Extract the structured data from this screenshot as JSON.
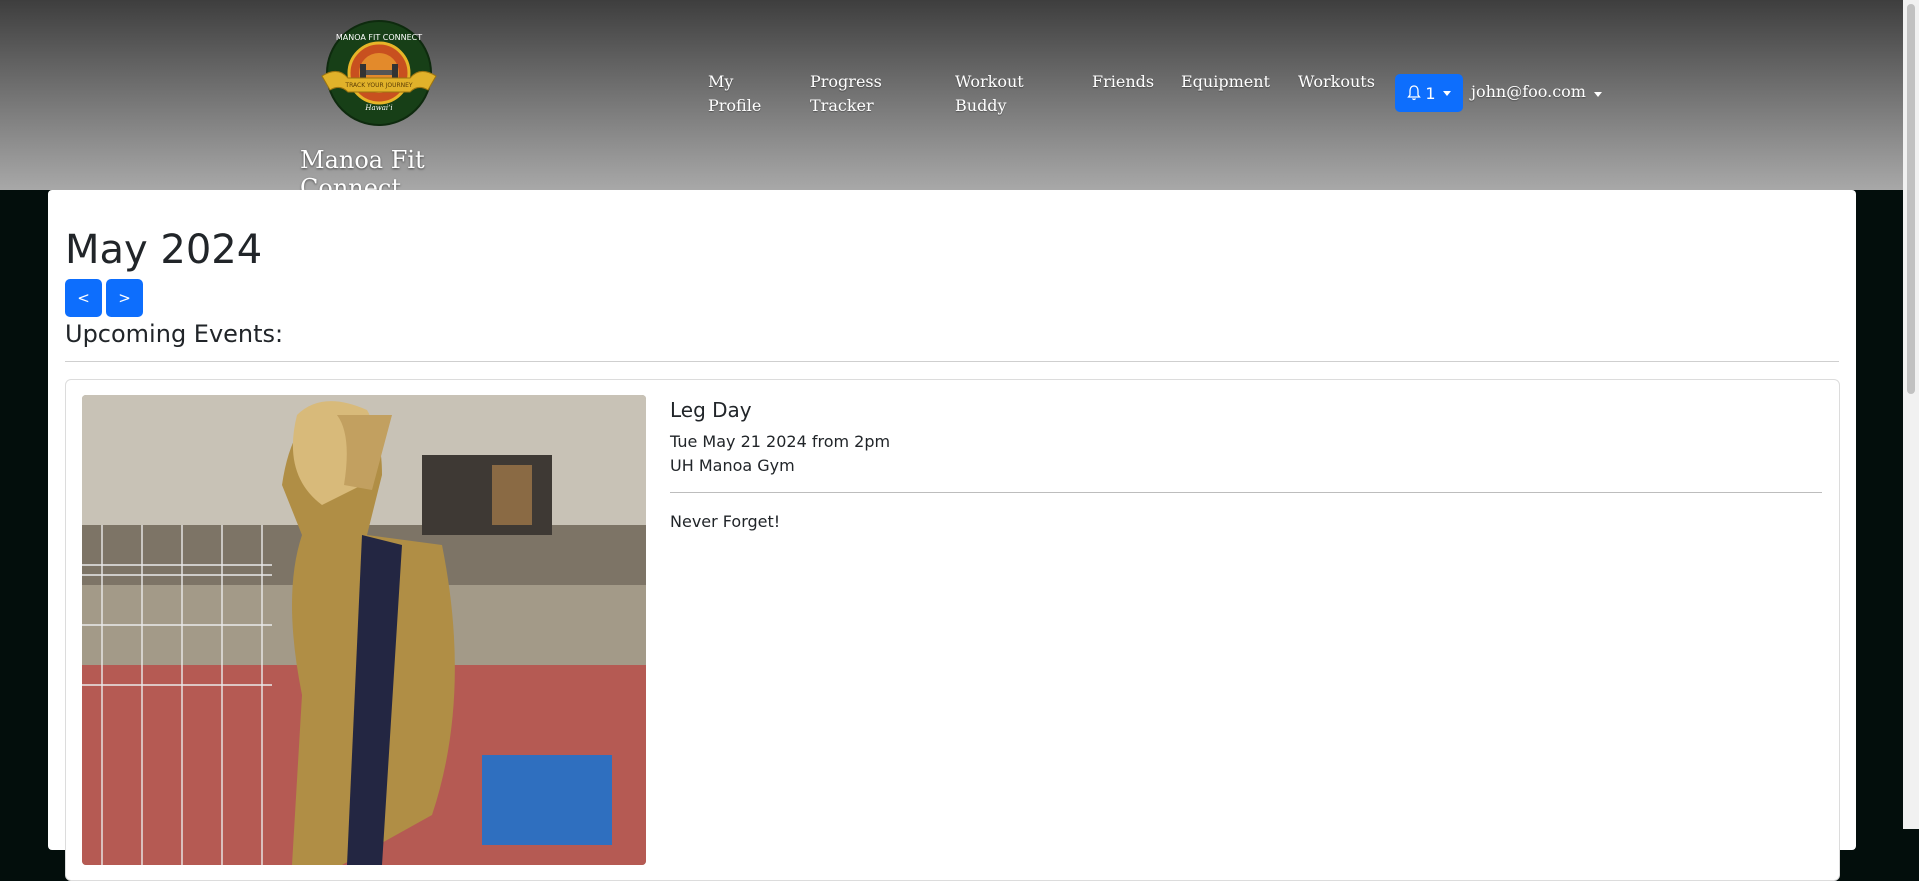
{
  "brand": {
    "name": "Manoa Fit Connect",
    "logo_text": "MANOA FIT CONNECT",
    "logo_sub": "Hawaiʻi"
  },
  "nav": {
    "my_profile": [
      "My",
      "Profile"
    ],
    "progress_tracker": [
      "Progress",
      "Tracker"
    ],
    "workout_buddy": [
      "Workout",
      "Buddy"
    ],
    "friends": "Friends",
    "equipment": "Equipment",
    "workouts": "Workouts",
    "notifications_count": "1",
    "user_email": "john@foo.com"
  },
  "calendar": {
    "month_label": "May 2024",
    "prev_label": "<",
    "next_label": ">",
    "upcoming_heading": "Upcoming Events:"
  },
  "events": [
    {
      "title": "Leg Day",
      "when": "Tue May 21 2024 from 2pm",
      "where": "UH Manoa Gym",
      "description": "Never Forget!"
    }
  ],
  "colors": {
    "primary": "#0d6efd",
    "page_bg": "#030e0c",
    "logo_green": "#1f4d1f",
    "logo_gold": "#d4a21a"
  },
  "icons": {
    "bell": "bell-icon",
    "caret": "caret-down-icon"
  }
}
